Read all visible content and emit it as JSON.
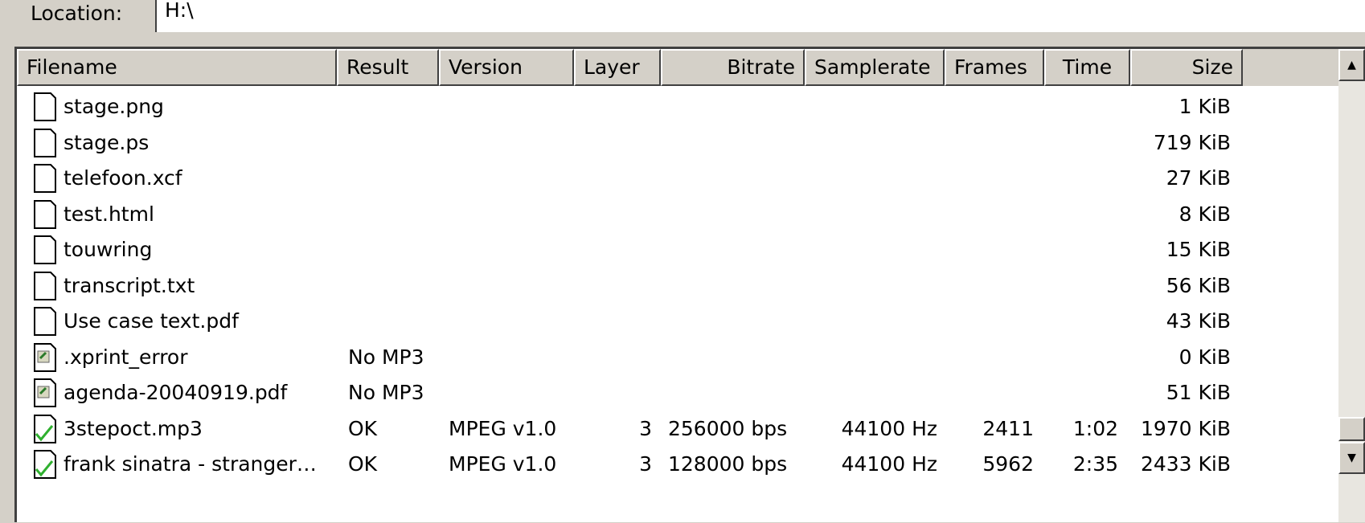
{
  "location": {
    "label": "Location:",
    "value": "H:\\"
  },
  "columns": [
    "Filename",
    "Result",
    "Version",
    "Layer",
    "Bitrate",
    "Samplerate",
    "Frames",
    "Time",
    "Size"
  ],
  "rows": [
    {
      "icon": "blank-file-icon",
      "filename": "stage.png",
      "result": "",
      "version": "",
      "layer": "",
      "bitrate": "",
      "samplerate": "",
      "frames": "",
      "time": "",
      "size": "1 KiB"
    },
    {
      "icon": "blank-file-icon",
      "filename": "stage.ps",
      "result": "",
      "version": "",
      "layer": "",
      "bitrate": "",
      "samplerate": "",
      "frames": "",
      "time": "",
      "size": "719 KiB"
    },
    {
      "icon": "blank-file-icon",
      "filename": "telefoon.xcf",
      "result": "",
      "version": "",
      "layer": "",
      "bitrate": "",
      "samplerate": "",
      "frames": "",
      "time": "",
      "size": "27 KiB"
    },
    {
      "icon": "blank-file-icon",
      "filename": "test.html",
      "result": "",
      "version": "",
      "layer": "",
      "bitrate": "",
      "samplerate": "",
      "frames": "",
      "time": "",
      "size": "8 KiB"
    },
    {
      "icon": "blank-file-icon",
      "filename": "touwring",
      "result": "",
      "version": "",
      "layer": "",
      "bitrate": "",
      "samplerate": "",
      "frames": "",
      "time": "",
      "size": "15 KiB"
    },
    {
      "icon": "blank-file-icon",
      "filename": "transcript.txt",
      "result": "",
      "version": "",
      "layer": "",
      "bitrate": "",
      "samplerate": "",
      "frames": "",
      "time": "",
      "size": "56 KiB"
    },
    {
      "icon": "blank-file-icon",
      "filename": "Use case text.pdf",
      "result": "",
      "version": "",
      "layer": "",
      "bitrate": "",
      "samplerate": "",
      "frames": "",
      "time": "",
      "size": "43 KiB"
    },
    {
      "icon": "error-file-icon",
      "filename": ".xprint_error",
      "result": "No MP3",
      "version": "",
      "layer": "",
      "bitrate": "",
      "samplerate": "",
      "frames": "",
      "time": "",
      "size": "0 KiB"
    },
    {
      "icon": "error-file-icon",
      "filename": "agenda-20040919.pdf",
      "result": "No MP3",
      "version": "",
      "layer": "",
      "bitrate": "",
      "samplerate": "",
      "frames": "",
      "time": "",
      "size": "51 KiB"
    },
    {
      "icon": "ok-file-icon",
      "filename": "3stepoct.mp3",
      "result": "OK",
      "version": "MPEG v1.0",
      "layer": "3",
      "bitrate": "256000 bps",
      "samplerate": "44100 Hz",
      "frames": "2411",
      "time": "1:02",
      "size": "1970 KiB"
    },
    {
      "icon": "ok-file-icon",
      "filename": "frank sinatra - stranger…",
      "result": "OK",
      "version": "MPEG v1.0",
      "layer": "3",
      "bitrate": "128000 bps",
      "samplerate": "44100 Hz",
      "frames": "5962",
      "time": "2:35",
      "size": "2433 KiB"
    }
  ],
  "scrollbar": {
    "up_glyph": "▲",
    "down_glyph": "▼"
  }
}
